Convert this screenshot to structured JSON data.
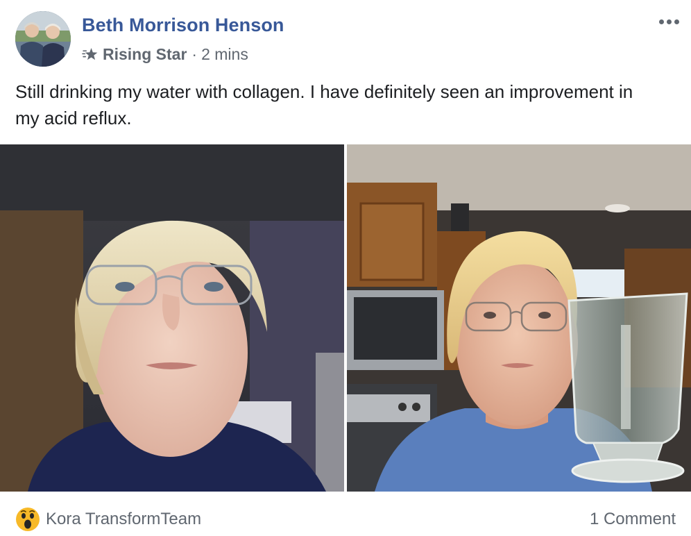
{
  "post": {
    "author": {
      "name": "Beth Morrison Henson",
      "avatar": "avatar-photo"
    },
    "badge": {
      "icon": "rising-star-icon",
      "label": "Rising Star"
    },
    "separator": "·",
    "timestamp": "2 mins",
    "more_icon": "more-options-icon",
    "text": "Still drinking my water with collagen. I have definitely seen an improvement in my acid reflux.",
    "photos": [
      {
        "name": "photo-before",
        "icon": "selfie-photo"
      },
      {
        "name": "photo-after",
        "icon": "selfie-with-glass-photo"
      }
    ],
    "reactions": {
      "icon": "wow-reaction-icon",
      "label": "Kora TransformTeam"
    },
    "comments": {
      "label": "1 Comment"
    }
  },
  "colors": {
    "author_blue": "#385898",
    "meta_gray": "#606770",
    "text_dark": "#1c1e21",
    "reaction_yellow": "#f7b928"
  }
}
